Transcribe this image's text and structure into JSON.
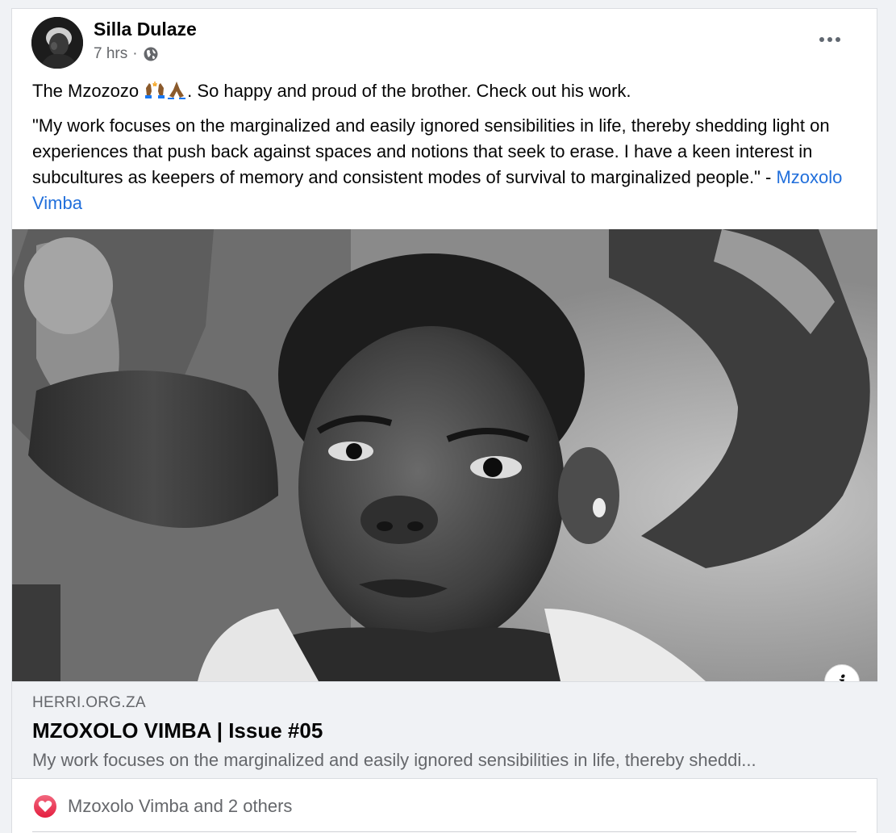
{
  "post": {
    "author": "Silla Dulaze",
    "time": "7 hrs",
    "separator": "·",
    "text_before_emoji": "The Mzozozo ",
    "emoji_1": "raised-hands-emoji",
    "emoji_2": "folded-hands-emoji",
    "text_after_emoji": ". So happy and proud of the brother. Check out his work.",
    "quote_text": "\"My work focuses on the marginalized and easily ignored sensibilities in life, thereby shedding light on experiences that push back against spaces and notions that seek to erase.  I have a keen interest in subcultures as keepers of memory and consistent modes of survival to marginalized people.\" - ",
    "quote_author_link": "Mzoxolo Vimba"
  },
  "link_preview": {
    "domain": "HERRI.ORG.ZA",
    "title": "MZOXOLO VIMBA | Issue #05",
    "description": "My work focuses on the marginalized and easily ignored sensibilities in life, thereby sheddi..."
  },
  "reactions": {
    "summary": "Mzoxolo Vimba and 2 others",
    "icon": "heart-icon"
  },
  "icons": {
    "privacy": "globe-icon",
    "more": "more-options-icon",
    "info": "info-icon"
  },
  "colors": {
    "link": "#216fdb",
    "heart": "#e41e3f",
    "secondary_text": "#65676b"
  }
}
